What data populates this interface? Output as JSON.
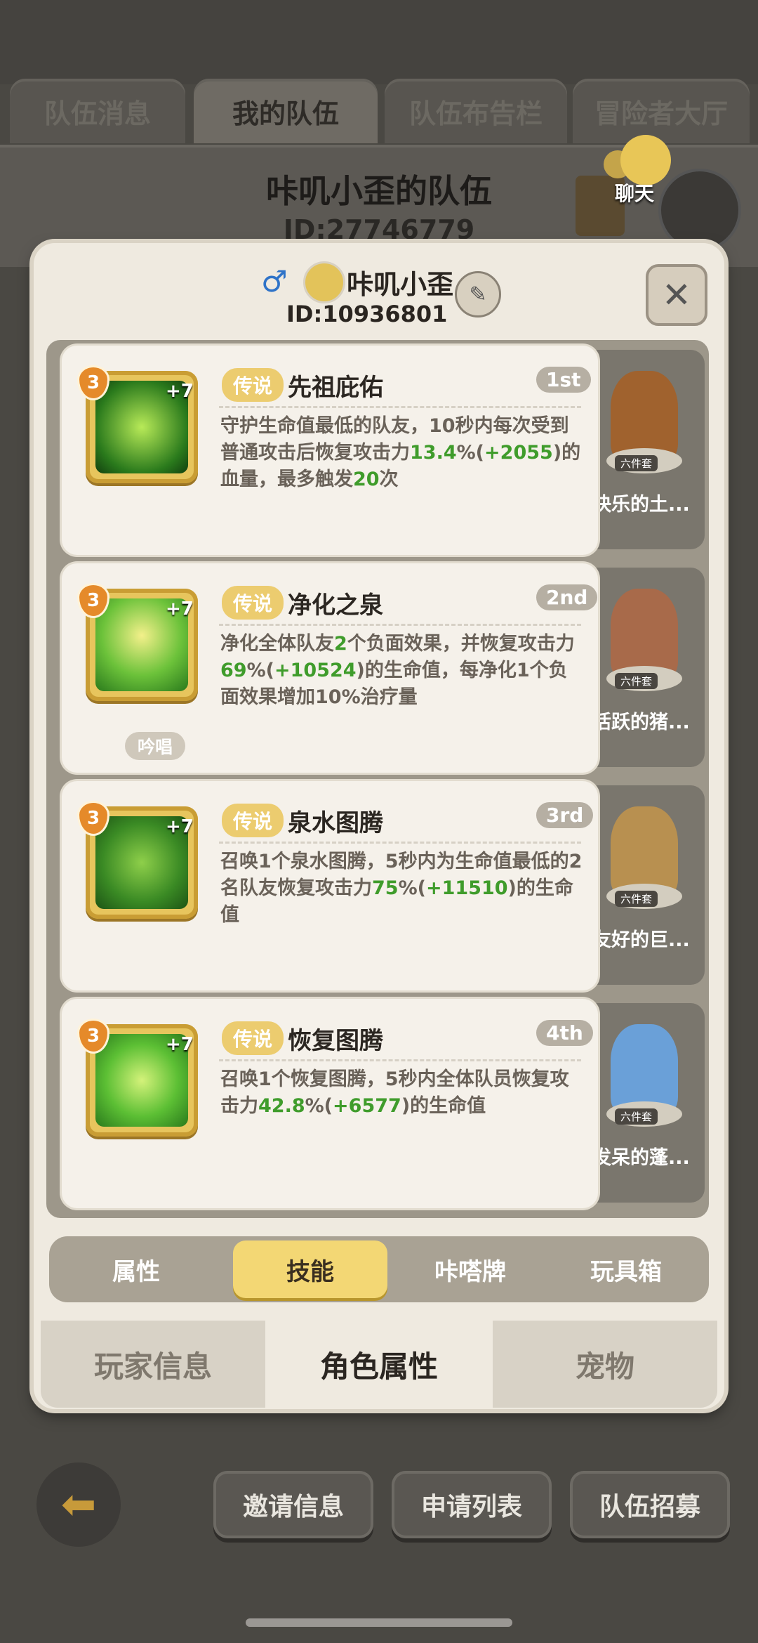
{
  "top_tabs": [
    "队伍消息",
    "我的队伍",
    "队伍布告栏",
    "冒险者大厅"
  ],
  "team": {
    "title": "咔叽小歪的队伍",
    "id": "ID:27746779"
  },
  "chat_label": "聊天",
  "player": {
    "gender_symbol": "♂",
    "name": "咔叽小歪",
    "id": "ID:10936801"
  },
  "skills": [
    {
      "level": "3",
      "plus": "+7",
      "rarity": "传说",
      "name": "先祖庇佑",
      "rank": "1st",
      "desc_parts": [
        "守护生命值最低的队友，10秒内每次受到普通攻击后恢复攻击力",
        "13.4",
        "%(",
        "+2055",
        ")的血量，最多触发",
        "20",
        "次"
      ],
      "companion": {
        "set": "六件套",
        "name": "快乐的土..."
      }
    },
    {
      "level": "3",
      "plus": "+7",
      "rarity": "传说",
      "name": "净化之泉",
      "rank": "2nd",
      "desc_parts": [
        "净化全体队友",
        "2",
        "个负面效果，并恢复攻击力",
        "69",
        "%(",
        "+10524",
        ")的生命值，每净化1个负面效果增加10%治疗量"
      ],
      "tag": "吟唱",
      "companion": {
        "set": "六件套",
        "name": "活跃的猪..."
      }
    },
    {
      "level": "3",
      "plus": "+7",
      "rarity": "传说",
      "name": "泉水图腾",
      "rank": "3rd",
      "desc_parts": [
        "召唤1个泉水图腾，5秒内为生命值最低的2名队友恢复攻击力",
        "75",
        "%(",
        "+11510",
        ")的生命值"
      ],
      "companion": {
        "set": "六件套",
        "name": "友好的巨..."
      }
    },
    {
      "level": "3",
      "plus": "+7",
      "rarity": "传说",
      "name": "恢复图腾",
      "rank": "4th",
      "desc_parts": [
        "召唤1个恢复图腾，5秒内全体队员恢复攻击力",
        "42.8",
        "%(",
        "+6577",
        ")的生命值"
      ],
      "companion": {
        "set": "六件套",
        "name": "发呆的蓬..."
      }
    }
  ],
  "sub_tabs": [
    "属性",
    "技能",
    "咔嗒牌",
    "玩具箱"
  ],
  "bottom_tabs": [
    "玩家信息",
    "角色属性",
    "宠物"
  ],
  "bottom_buttons": [
    "邀请信息",
    "申请列表",
    "队伍招募"
  ],
  "colors": {
    "highlight_green": "#3f9c2b",
    "gold": "#f3d774",
    "rarity_badge": "#eccc6f"
  }
}
